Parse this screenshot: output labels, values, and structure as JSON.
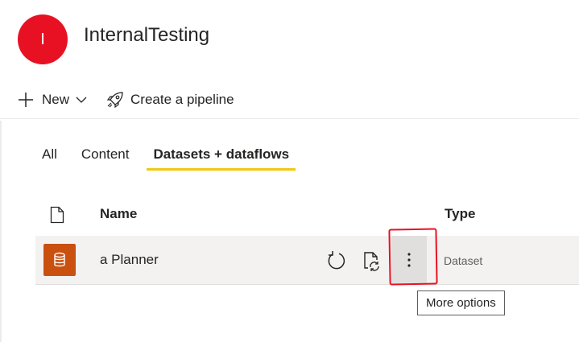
{
  "workspace": {
    "avatar_initial": "I",
    "avatar_color": "#e81123",
    "title": "InternalTesting"
  },
  "toolbar": {
    "new_label": "New",
    "pipeline_label": "Create a pipeline"
  },
  "tabs": [
    {
      "label": "All",
      "active": false
    },
    {
      "label": "Content",
      "active": false
    },
    {
      "label": "Datasets + dataflows",
      "active": true
    }
  ],
  "table": {
    "columns": {
      "icon": "document-icon",
      "name": "Name",
      "type": "Type"
    },
    "rows": [
      {
        "name": "a Planner",
        "type": "Dataset",
        "icon": "database-icon",
        "icon_color": "#ca5010"
      }
    ]
  },
  "tooltip": {
    "text": "More options"
  },
  "colors": {
    "accent_underline": "#f2c811",
    "annotation": "#e81123"
  }
}
